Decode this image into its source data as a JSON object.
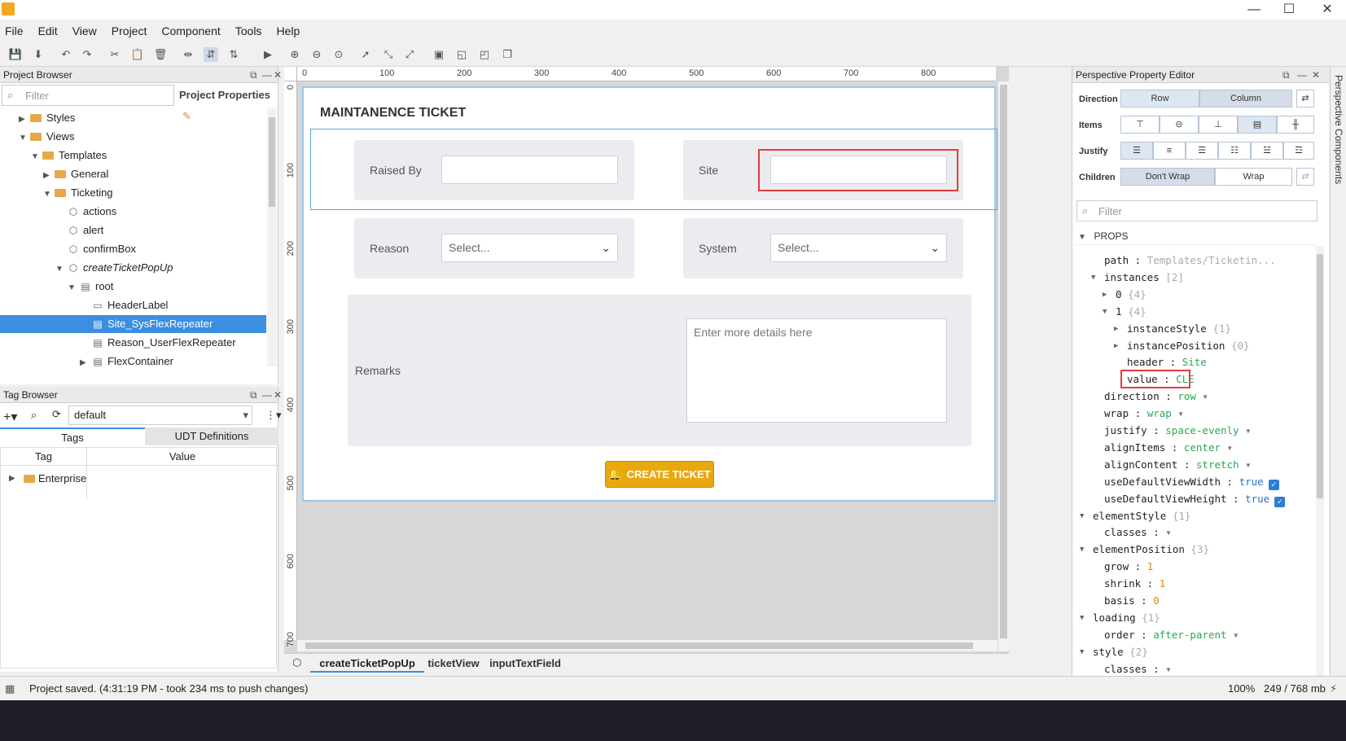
{
  "menu": [
    "File",
    "Edit",
    "View",
    "Project",
    "Component",
    "Tools",
    "Help"
  ],
  "window_controls": {
    "minimize": "—",
    "maximize": "☐",
    "close": "✕"
  },
  "project_browser": {
    "title": "Project Browser",
    "filter_placeholder": "Filter",
    "project_properties": "Project Properties",
    "tree": [
      {
        "label": "Styles",
        "indent": 1,
        "kind": "folder",
        "arrow": "▶"
      },
      {
        "label": "Views",
        "indent": 1,
        "kind": "folder",
        "arrow": "▼"
      },
      {
        "label": "Templates",
        "indent": 2,
        "kind": "folder",
        "arrow": "▼"
      },
      {
        "label": "General",
        "indent": 3,
        "kind": "folder",
        "arrow": "▶"
      },
      {
        "label": "Ticketing",
        "indent": 3,
        "kind": "folder",
        "arrow": "▼"
      },
      {
        "label": "actions",
        "indent": 4,
        "kind": "view",
        "arrow": ""
      },
      {
        "label": "alert",
        "indent": 4,
        "kind": "view",
        "arrow": ""
      },
      {
        "label": "confirmBox",
        "indent": 4,
        "kind": "view",
        "arrow": ""
      },
      {
        "label": "createTicketPopUp",
        "indent": 4,
        "kind": "view",
        "arrow": "▼",
        "italic": true
      },
      {
        "label": "root",
        "indent": 5,
        "kind": "comp",
        "arrow": "▼"
      },
      {
        "label": "HeaderLabel",
        "indent": 6,
        "kind": "label",
        "arrow": ""
      },
      {
        "label": "Site_SysFlexRepeater",
        "indent": 6,
        "kind": "comp",
        "arrow": "",
        "selected": true
      },
      {
        "label": "Reason_UserFlexRepeater",
        "indent": 6,
        "kind": "comp",
        "arrow": ""
      },
      {
        "label": "FlexContainer",
        "indent": 6,
        "kind": "comp",
        "arrow": "▶"
      }
    ]
  },
  "tag_browser": {
    "title": "Tag Browser",
    "provider": "default",
    "tabs": [
      "Tags",
      "UDT Definitions"
    ],
    "columns": [
      "Tag",
      "Value"
    ],
    "rows": [
      {
        "tag": "Enterprise",
        "value": ""
      }
    ]
  },
  "canvas": {
    "ruler_h": [
      "0",
      "100",
      "200",
      "300",
      "400",
      "500",
      "600",
      "700",
      "800"
    ],
    "ruler_v": [
      "0",
      "100",
      "200",
      "300",
      "400",
      "500",
      "600",
      "700"
    ],
    "header": "MAINTANENCE TICKET",
    "raised_by_label": "Raised By",
    "site_label": "Site",
    "reason_label": "Reason",
    "reason_select": "Select...",
    "system_label": "System",
    "system_select": "Select...",
    "remarks_label": "Remarks",
    "remarks_placeholder": "Enter more details here",
    "create_button": "CREATE TICKET"
  },
  "doc_tabs": [
    "createTicketPopUp",
    "ticketView",
    "inputTextField"
  ],
  "property_editor": {
    "title": "Perspective Property Editor",
    "side_tab": "Perspective Components",
    "direction_label": "Direction",
    "direction_options": [
      "Row",
      "Column"
    ],
    "items_label": "Items",
    "justify_label": "Justify",
    "children_label": "Children",
    "children_options": [
      "Don't Wrap",
      "Wrap"
    ],
    "filter_placeholder": "Filter",
    "section": "PROPS",
    "props": [
      {
        "key": "path",
        "sep": " : ",
        "val": "Templates/Ticketin...",
        "cls": "muted",
        "indent": 0
      },
      {
        "key": "instances",
        "sep": " ",
        "val": "[2]",
        "cls": "muted",
        "indent": 0
      },
      {
        "key": "0",
        "sep": " ",
        "val": "{4}",
        "cls": "muted",
        "indent": 1
      },
      {
        "key": "1",
        "sep": " ",
        "val": "{4}",
        "cls": "muted",
        "indent": 1
      },
      {
        "key": "instanceStyle",
        "sep": " ",
        "val": "{1}",
        "cls": "muted",
        "indent": 2
      },
      {
        "key": "instancePosition",
        "sep": " ",
        "val": "{0}",
        "cls": "muted",
        "indent": 2
      },
      {
        "key": "header",
        "sep": " : ",
        "val": "Site",
        "cls": "v",
        "indent": 2
      },
      {
        "key": "value",
        "sep": " : ",
        "val": "CLE",
        "cls": "v",
        "indent": 2
      },
      {
        "key": "direction",
        "sep": " : ",
        "val": "row",
        "cls": "v",
        "indent": 0
      },
      {
        "key": "wrap",
        "sep": " : ",
        "val": "wrap",
        "cls": "v",
        "indent": 0
      },
      {
        "key": "justify",
        "sep": " : ",
        "val": "space-evenly",
        "cls": "v",
        "indent": 0
      },
      {
        "key": "alignItems",
        "sep": " : ",
        "val": "center",
        "cls": "v",
        "indent": 0
      },
      {
        "key": "alignContent",
        "sep": " : ",
        "val": "stretch",
        "cls": "v",
        "indent": 0
      },
      {
        "key": "useDefaultViewWidth",
        "sep": " : ",
        "val": "true",
        "cls": "vb",
        "indent": 0
      },
      {
        "key": "useDefaultViewHeight",
        "sep": " : ",
        "val": "true",
        "cls": "vb",
        "indent": 0
      },
      {
        "key": "elementStyle",
        "sep": " ",
        "val": "{1}",
        "cls": "muted",
        "indent": -1
      },
      {
        "key": "classes",
        "sep": " : ",
        "val": "",
        "cls": "v",
        "indent": 0
      },
      {
        "key": "elementPosition",
        "sep": " ",
        "val": "{3}",
        "cls": "muted",
        "indent": -1
      },
      {
        "key": "grow",
        "sep": " : ",
        "val": "1",
        "cls": "vo",
        "indent": 0
      },
      {
        "key": "shrink",
        "sep": " : ",
        "val": "1",
        "cls": "vo",
        "indent": 0
      },
      {
        "key": "basis",
        "sep": " : ",
        "val": "0",
        "cls": "vo",
        "indent": 0
      },
      {
        "key": "loading",
        "sep": " ",
        "val": "{1}",
        "cls": "muted",
        "indent": -1
      },
      {
        "key": "order",
        "sep": " : ",
        "val": "after-parent",
        "cls": "v",
        "indent": 0
      },
      {
        "key": "style",
        "sep": " ",
        "val": "{2}",
        "cls": "muted",
        "indent": -1
      },
      {
        "key": "classes",
        "sep": " : ",
        "val": "",
        "cls": "v",
        "indent": 0
      }
    ]
  },
  "status": {
    "message": "Project saved. (4:31:19 PM - took 234 ms to push changes)",
    "zoom": "100%",
    "memory": "249 / 768 mb"
  }
}
